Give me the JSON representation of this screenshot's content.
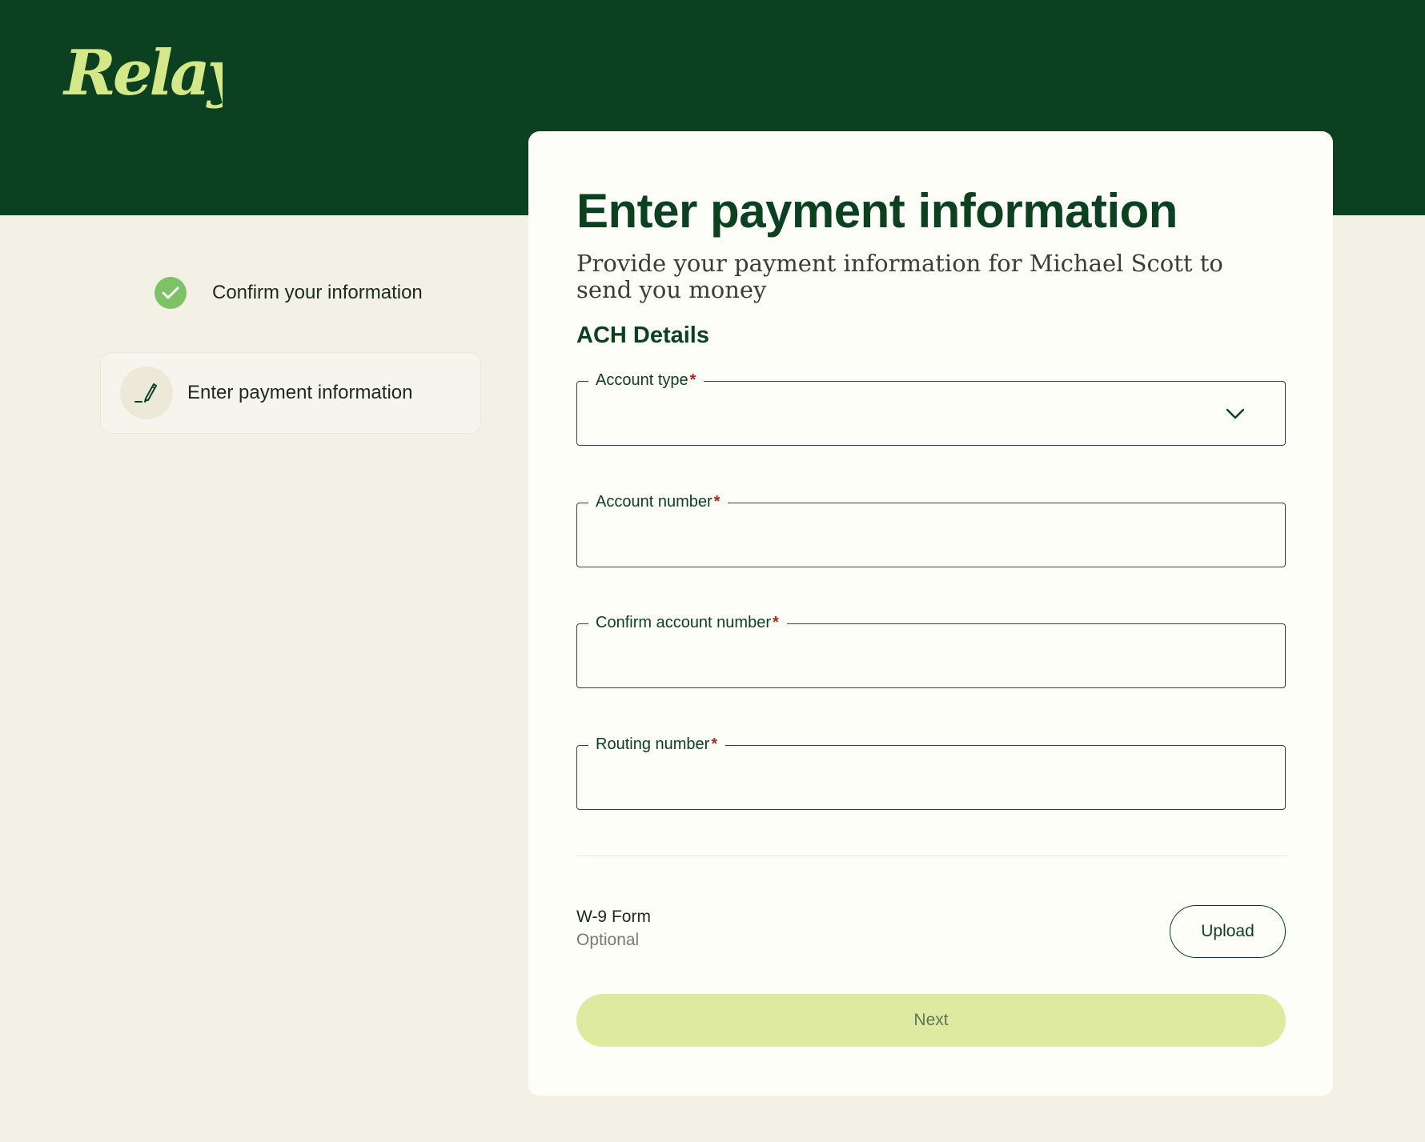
{
  "brand": {
    "logo_text": "Relay",
    "colors": {
      "header": "#0b4121",
      "page_background": "#f3f1e6",
      "card_background": "#fefef8",
      "logo": "#d4e889",
      "success": "#7dc267",
      "next_button": "#deea9f",
      "required": "#b3261e"
    }
  },
  "stepper": {
    "steps": [
      {
        "label": "Confirm your information",
        "icon": "check-circle-icon",
        "status": "completed"
      },
      {
        "label": "Enter payment information",
        "icon": "pencil-icon",
        "status": "current"
      }
    ]
  },
  "form": {
    "title": "Enter payment information",
    "subtitle": "Provide your payment information for Michael Scott to send you money",
    "section_title": "ACH Details",
    "required_marker": "*",
    "fields": {
      "account_type": {
        "label": "Account type",
        "value": "",
        "icon": "chevron-down-icon"
      },
      "account_number": {
        "label": "Account number",
        "value": ""
      },
      "confirm_account_number": {
        "label": "Confirm account number",
        "value": ""
      },
      "routing_number": {
        "label": "Routing number",
        "value": ""
      }
    },
    "w9": {
      "title": "W-9 Form",
      "optional_label": "Optional",
      "upload_label": "Upload"
    },
    "next_label": "Next"
  }
}
